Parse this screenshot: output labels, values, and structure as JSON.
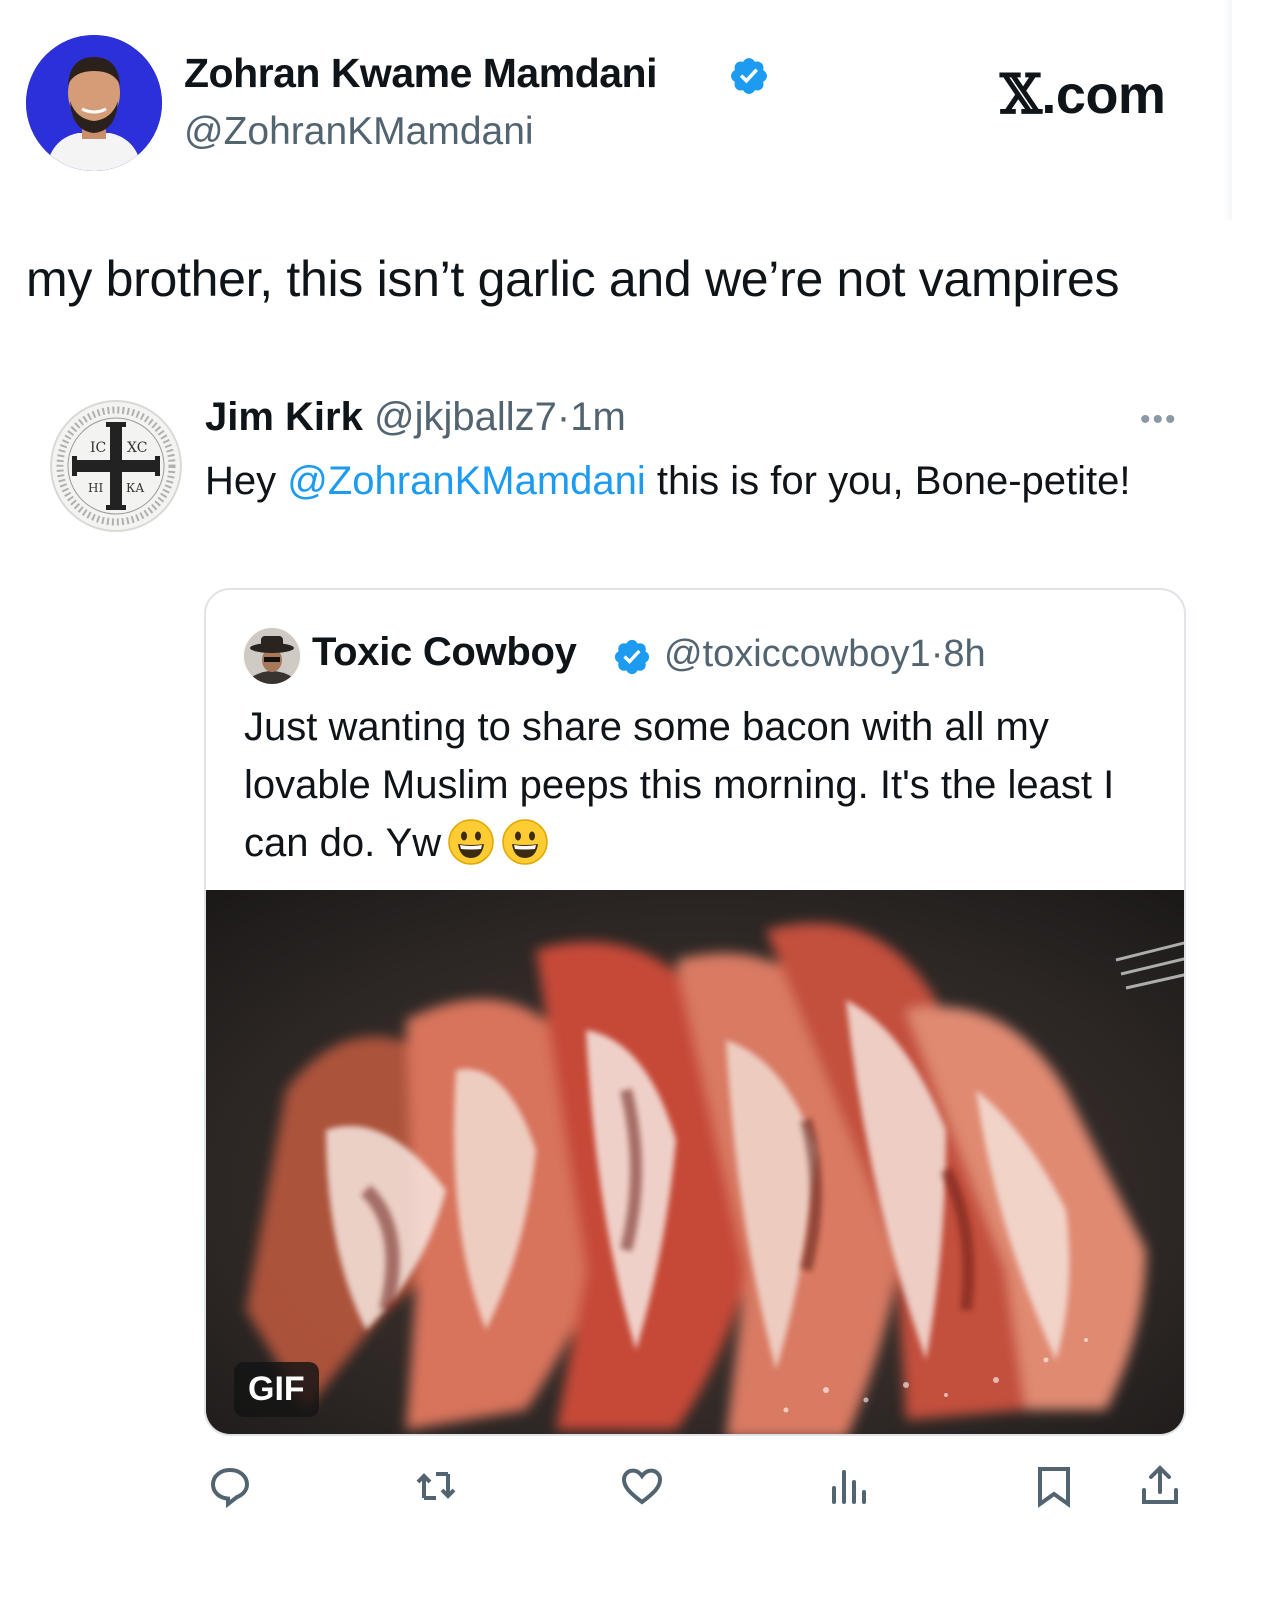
{
  "author": {
    "name": "Zohran Kwame Mamdani",
    "handle": "@ZohranKMamdani",
    "verified_color": "#1d9bf0",
    "avatar_bg": "#2c30d8"
  },
  "brand": {
    "x": "𝕏",
    "suffix": ".com"
  },
  "tweet": {
    "text": "my brother, this isn’t garlic and we’re not vampires"
  },
  "reply": {
    "name": "Jim Kirk",
    "handle": "@jkjballz7",
    "separator": "·",
    "time": "1m",
    "more": "•••",
    "text_prefix": "Hey ",
    "mention": "@ZohranKMamdani",
    "text_suffix": " this is for you, Bone-petite!"
  },
  "quote": {
    "name": "Toxic Cowboy",
    "handle": "@toxiccowboy1",
    "separator": "·",
    "time": "8h",
    "text": "Just wanting to share some bacon with all my lovable Muslim peeps this morning. It's the least I can do. Yw",
    "emojis": [
      "grinning-face-emoji",
      "grinning-face-emoji"
    ],
    "media_badge": "GIF"
  },
  "actions": [
    {
      "icon": "reply-icon"
    },
    {
      "icon": "retweet-icon"
    },
    {
      "icon": "like-icon"
    },
    {
      "icon": "views-icon"
    },
    {
      "icon": "bookmark-icon"
    },
    {
      "icon": "share-icon"
    }
  ],
  "colors": {
    "link": "#1d9bf0",
    "secondary_text": "#536471",
    "primary_text": "#0f1419"
  }
}
